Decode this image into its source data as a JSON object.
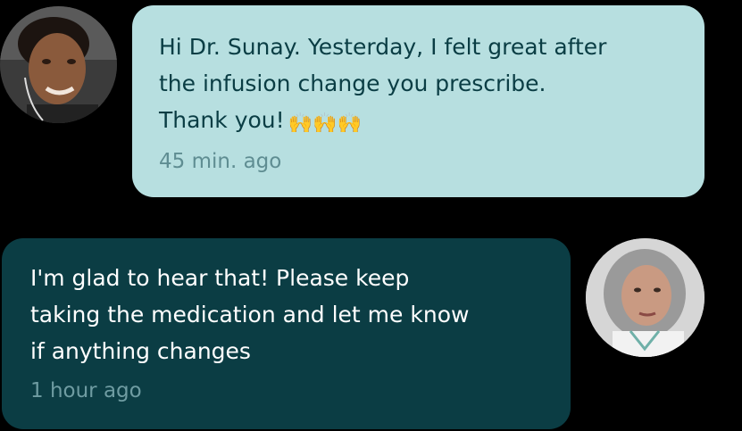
{
  "conversation": {
    "messages": [
      {
        "sender": "patient",
        "avatar_icon": "patient-avatar",
        "text": "Hi Dr. Sunay. Yesterday, I felt great after\nthe infusion change you prescribe.\nThank you!",
        "emoji": "🙌🙌🙌",
        "time": "45 min. ago"
      },
      {
        "sender": "doctor",
        "avatar_icon": "doctor-avatar",
        "text": "I'm glad to hear that! Please keep\ntaking the medication and let me know\nif anything changes",
        "time": "1 hour ago"
      }
    ]
  },
  "colors": {
    "background": "#000000",
    "patient_bubble": "#b7dfe0",
    "patient_text": "#0a3d44",
    "doctor_bubble": "#0b3d44",
    "doctor_text": "#ffffff",
    "timestamp_light": "#5f8d92",
    "timestamp_dark": "#6f9ca2"
  }
}
